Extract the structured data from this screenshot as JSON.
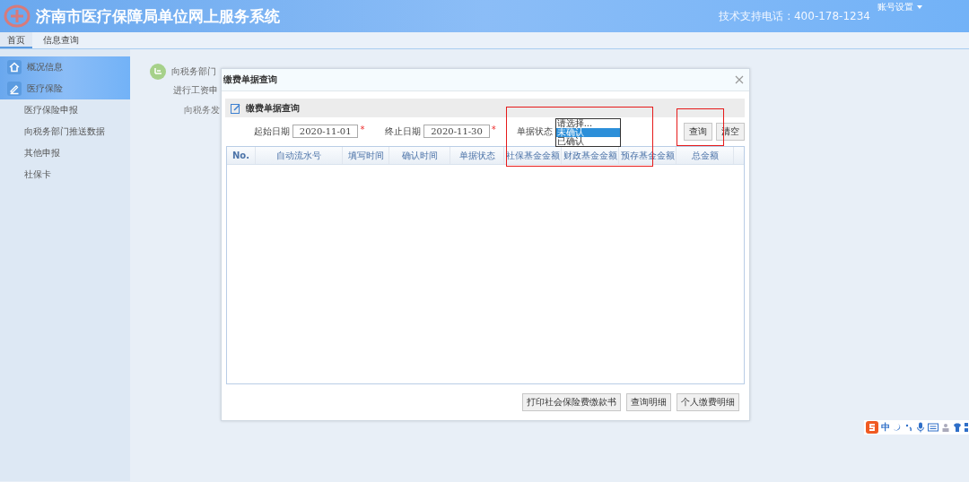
{
  "header": {
    "title": "济南市医疗保障局单位网上服务系统",
    "support": "技术支持电话 : 400-178-1234",
    "account_menu": "账号设置"
  },
  "nav_tabs": [
    {
      "label": "首页",
      "selected": true
    },
    {
      "label": "信息查询",
      "selected": false
    }
  ],
  "sidebar": {
    "items": [
      {
        "label": "概况信息",
        "kind": "header"
      },
      {
        "label": "医疗保险",
        "kind": "header"
      },
      {
        "label": "医疗保险申报",
        "kind": "sub"
      },
      {
        "label": "向税务部门推送数据",
        "kind": "sub"
      },
      {
        "label": "其他申报",
        "kind": "sub"
      },
      {
        "label": "社保卡",
        "kind": "sub"
      }
    ]
  },
  "page": {
    "title": "向税务部门",
    "line_1": "进行工资申",
    "line_2": "向税务发"
  },
  "dialog": {
    "title": "缴费单据查询",
    "section_title": "缴费单据查询",
    "start_date": {
      "label": "起始日期",
      "value": "2020-11-01",
      "required_mark": "*"
    },
    "end_date": {
      "label": "终止日期",
      "value": "2020-11-30",
      "required_mark": "*"
    },
    "status": {
      "label": "单据状态",
      "options": [
        {
          "label": "请选择...",
          "selected": false
        },
        {
          "label": "未确认",
          "selected": true
        },
        {
          "label": "已确认",
          "selected": false
        }
      ]
    },
    "query_button": "查询",
    "clear_button": "清空",
    "table": {
      "columns": [
        "No.",
        "自动流水号",
        "填写时间",
        "确认时间",
        "单据状态",
        "社保基金金额",
        "财政基金金额",
        "预存基金金额",
        "总金额"
      ]
    },
    "footer_buttons": [
      "打印社会保险费缴款书",
      "查询明细",
      "个人缴费明细"
    ]
  },
  "ime_toolbar": {
    "mode": "中"
  }
}
